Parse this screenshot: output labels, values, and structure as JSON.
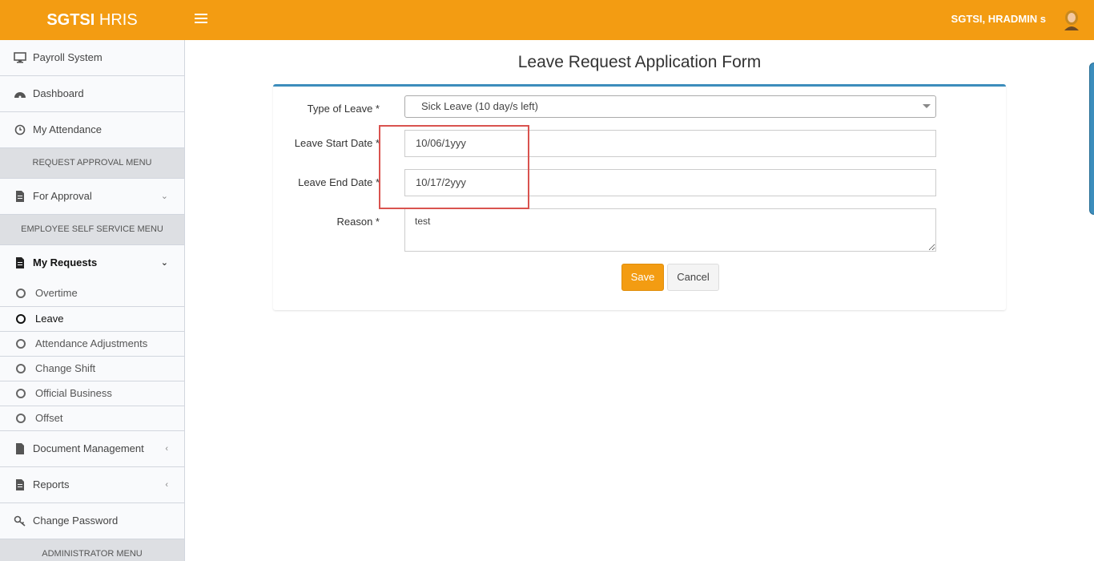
{
  "header": {
    "brand_bold": "SGTSI",
    "brand_rest": "HRIS",
    "user_name": "SGTSI, HRADMIN s"
  },
  "sidebar": {
    "items_top": [
      {
        "label": "Payroll System",
        "icon": "desktop-icon"
      },
      {
        "label": "Dashboard",
        "icon": "dashboard-icon"
      },
      {
        "label": "My Attendance",
        "icon": "clock-icon"
      }
    ],
    "section_request_approval": "REQUEST APPROVAL MENU",
    "for_approval": "For Approval",
    "section_self_service": "EMPLOYEE SELF SERVICE MENU",
    "my_requests": "My Requests",
    "sub_items": [
      "Overtime",
      "Leave",
      "Attendance Adjustments",
      "Change Shift",
      "Official Business",
      "Offset"
    ],
    "document_management": "Document Management",
    "reports": "Reports",
    "change_password": "Change Password",
    "section_administrator": "ADMINISTRATOR MENU",
    "active_sub": "Leave"
  },
  "form": {
    "title": "Leave Request Application Form",
    "type_label": "Type of Leave *",
    "type_value": "Sick Leave (10 day/s left)",
    "start_label": "Leave Start Date *",
    "start_value": "10/06/1yyy",
    "end_label": "Leave End Date *",
    "end_value": "10/17/2yyy",
    "reason_label": "Reason *",
    "reason_value": "test",
    "save_label": "Save",
    "cancel_label": "Cancel"
  },
  "colors": {
    "header_bg": "#f39c12",
    "box_top_border": "#3c8dbc",
    "highlight": "#d9534f"
  }
}
